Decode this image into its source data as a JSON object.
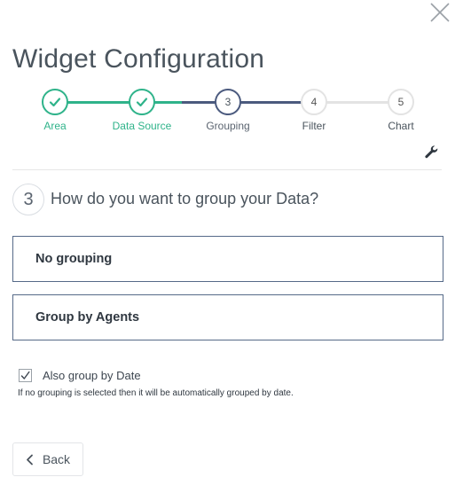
{
  "dialog": {
    "title": "Widget Configuration"
  },
  "stepper": {
    "steps": [
      {
        "label": "Area",
        "number": "1",
        "state": "done"
      },
      {
        "label": "Data Source",
        "number": "2",
        "state": "done"
      },
      {
        "label": "Grouping",
        "number": "3",
        "state": "current"
      },
      {
        "label": "Filter",
        "number": "4",
        "state": "future"
      },
      {
        "label": "Chart",
        "number": "5",
        "state": "future"
      }
    ]
  },
  "question": {
    "number": "3",
    "text": "How do you want to group your Data?"
  },
  "options": [
    {
      "label": "No grouping"
    },
    {
      "label": "Group by Agents"
    }
  ],
  "date_grouping": {
    "label": "Also group by Date",
    "checked": true,
    "hint": "If no grouping is selected then it will be automatically grouped by date."
  },
  "footer": {
    "back_label": "Back"
  },
  "colors": {
    "done": "#2fb38a",
    "current": "#4b5a7e",
    "future": "#e3e3e3",
    "option_border": "#566a88"
  },
  "icons": {
    "close": "close-icon",
    "check": "checkmark-icon",
    "wrench": "wrench-icon",
    "back": "chevron-left-icon"
  }
}
